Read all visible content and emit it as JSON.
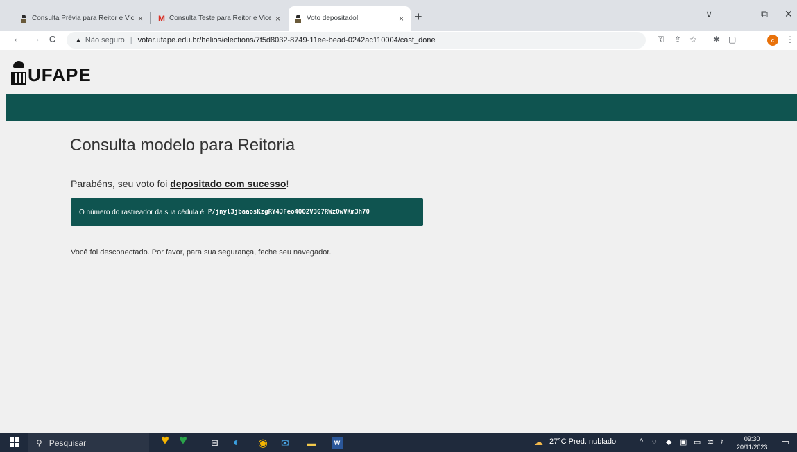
{
  "browser": {
    "tabs": [
      {
        "title": "Consulta Prévia para Reitor e Vic",
        "favicon": "helios-icon",
        "active": false
      },
      {
        "title": "Consulta Teste para Reitor e Vice",
        "favicon": "gmail-icon",
        "active": false
      },
      {
        "title": "Voto depositado!",
        "favicon": "helios-icon",
        "active": true
      }
    ],
    "new_tab_label": "+",
    "tab_close_glyph": "×",
    "window_controls": {
      "menu": "∨",
      "minimize": "–",
      "restore": "⧉",
      "close": "✕"
    },
    "toolbar": {
      "back": "←",
      "forward": "→",
      "reload": "C",
      "security_label": "Não seguro",
      "url": "votar.ufape.edu.br/helios/elections/7f5d8032-8749-11ee-bead-0242ac110004/cast_done",
      "profile_initial": "c"
    }
  },
  "page": {
    "logo_text": "UFAPE",
    "title": "Consulta modelo para Reitoria",
    "congrats_prefix": "Parabéns, seu voto foi ",
    "congrats_emph": "depositado com sucesso",
    "congrats_suffix": "!",
    "tracker_label": "O número do rastreador da sua cédula é:",
    "tracker_code": "P/jnyl3jbaaosKzgRY4JFeo4QQ2V3G7RWzOwVKm3h70",
    "logged_out_message": "Você foi desconectado. Por favor, para sua segurança, feche seu navegador."
  },
  "taskbar": {
    "search_placeholder": "Pesquisar",
    "weather": "27°C  Pred. nublado",
    "time": "09:30",
    "date": "20/11/2023"
  },
  "colors": {
    "brand_green": "#0f5450",
    "page_background": "#f0f0f0",
    "taskbar": "#1f2a3c"
  }
}
